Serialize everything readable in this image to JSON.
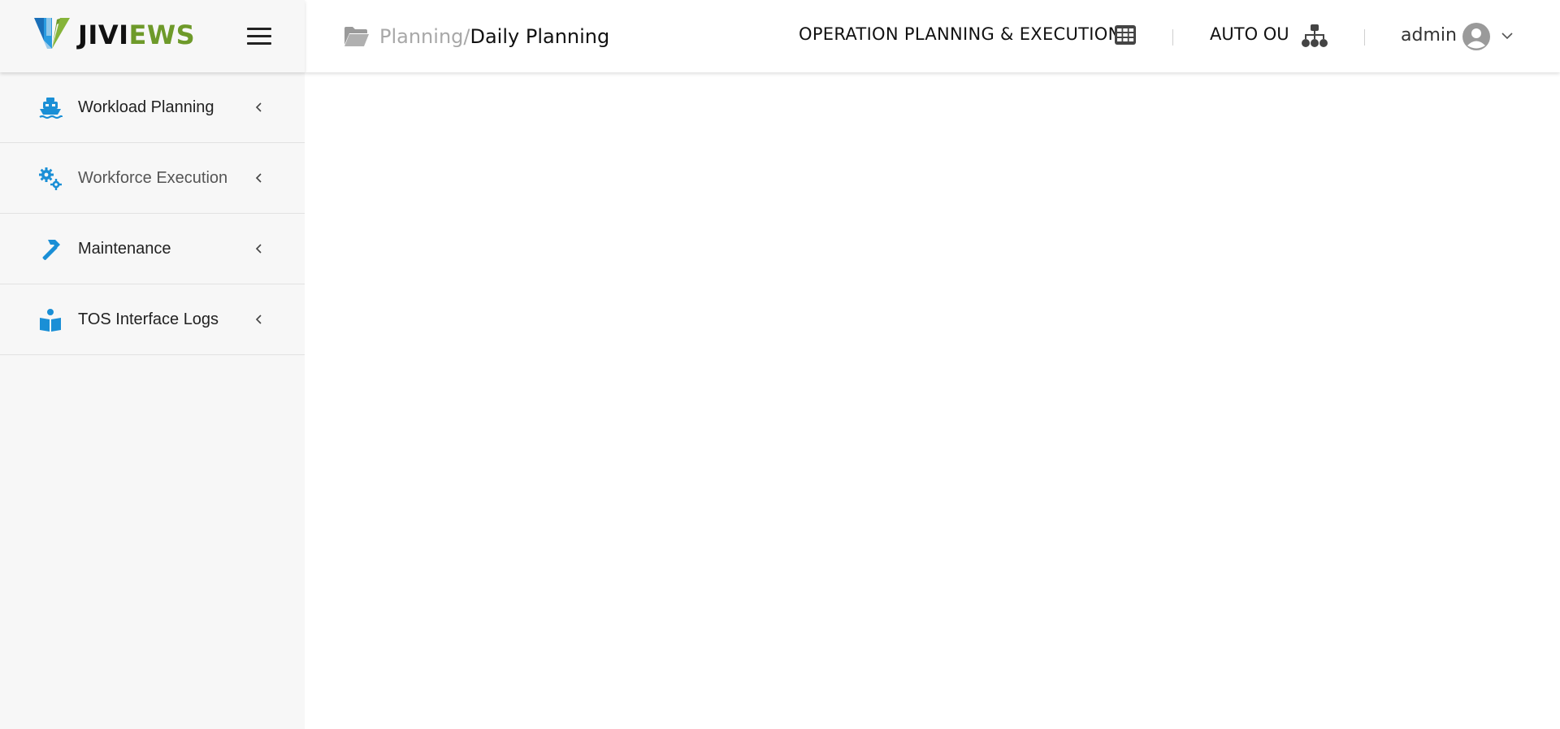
{
  "brand": {
    "name_dark": "JIVI",
    "name_green": "EWS",
    "green_color": "#6e9a2a"
  },
  "icons": {
    "menu": "hamburger-icon",
    "breadcrumb": "folder-open-icon",
    "module": "grid-icon",
    "ou": "sitemap-icon",
    "user": "user-circle-icon",
    "user_menu": "chevron-down-icon"
  },
  "sidebar": {
    "items": [
      {
        "label": "Workload Planning",
        "icon": "ship-icon"
      },
      {
        "label": "Workforce Execution",
        "icon": "cogs-icon"
      },
      {
        "label": "Maintenance",
        "icon": "hammer-icon"
      },
      {
        "label": "TOS Interface Logs",
        "icon": "book-reader-icon"
      }
    ],
    "icon_color": "#1a8fd6"
  },
  "header": {
    "breadcrumb": {
      "parent": "Planning",
      "separator": "/",
      "current": "Daily Planning"
    },
    "module": "OPERATION PLANNING & EXECUTION",
    "ou": "AUTO OU",
    "user": "admin"
  }
}
